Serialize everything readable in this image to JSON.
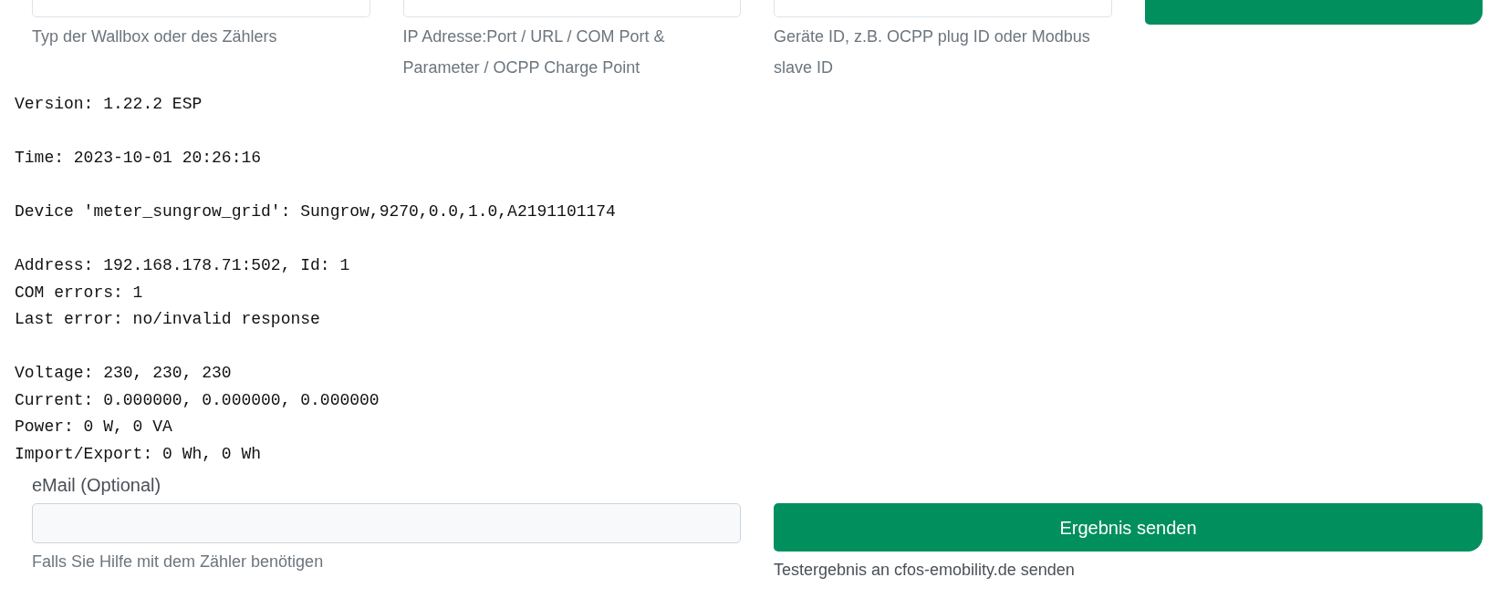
{
  "top_row": [
    {
      "kind": "field",
      "hint": "Typ der Wallbox oder des Zählers"
    },
    {
      "kind": "field",
      "hint": "IP Adresse:Port / URL / COM Port & Parameter / OCPP Charge Point"
    },
    {
      "kind": "field",
      "hint": "Geräte ID, z.B. OCPP plug ID oder Modbus slave ID"
    },
    {
      "kind": "button"
    }
  ],
  "output": [
    {
      "lines": [
        "Version: 1.22.2 ESP"
      ]
    },
    {
      "lines": [
        "Time: 2023-10-01 20:26:16"
      ]
    },
    {
      "lines": [
        "Device 'meter_sungrow_grid': Sungrow,9270,0.0,1.0,A2191101174"
      ]
    },
    {
      "lines": [
        "Address: 192.168.178.71:502, Id: 1",
        "COM errors: 1",
        "Last error: no/invalid response"
      ]
    },
    {
      "lines": [
        "Voltage: 230, 230, 230",
        "Current: 0.000000, 0.000000, 0.000000",
        "Power: 0 W, 0 VA",
        "Import/Export: 0 Wh, 0 Wh"
      ]
    }
  ],
  "email": {
    "label": "eMail (Optional)",
    "hint": "Falls Sie Hilfe mit dem Zähler benötigen"
  },
  "send": {
    "label": "Ergebnis senden",
    "caption": "Testergebnis an cfos-emobility.de senden"
  }
}
